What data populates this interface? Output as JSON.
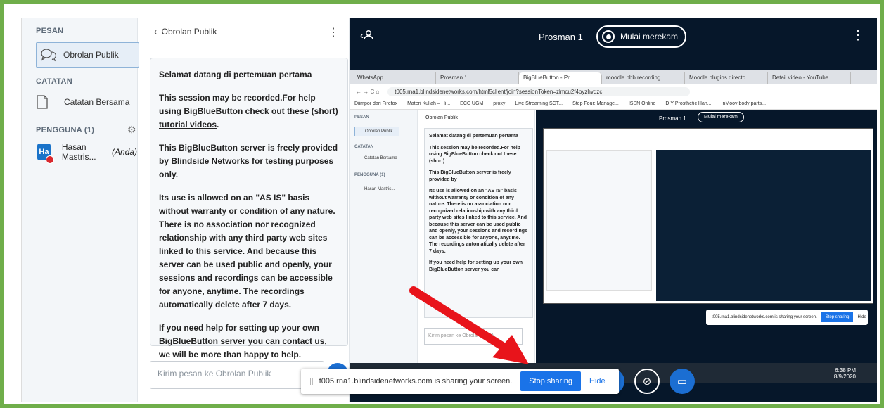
{
  "sidebar": {
    "messages_title": "PESAN",
    "public_chat": "Obrolan Publik",
    "notes_title": "CATATAN",
    "shared_notes": "Catatan Bersama",
    "users_title": "PENGGUNA (1)",
    "user": {
      "initials": "Ha",
      "name": "Hasan Mastris...",
      "role": "(Anda)"
    }
  },
  "chat": {
    "back_label": "Obrolan Publik",
    "welcome_title": "Selamat datang di pertemuan pertama",
    "p1_a": "This session may be recorded.For help using BigBlueButton check out these (short) ",
    "p1_link": "tutorial videos",
    "p1_end": ".",
    "p2_a": "This BigBlueButton server is freely provided by ",
    "p2_link": "Blindside Networks",
    "p2_b": " for testing purposes only.",
    "p3": "Its use is allowed on an \"AS IS\" basis without warranty or condition of any nature. There is no association nor recognized relationship with any third party web sites linked to this service. And because this server can be used public and openly, your sessions and recordings can be accessible for anyone, anytime. The recordings automatically delete after 7 days.",
    "p4_a": "If you need help for setting up your own BigBlueButton server you can ",
    "p4_link": "contact us",
    "p4_b": ", we will be more than happy to help.",
    "input_placeholder": "Kirim pesan ke Obrolan Publik"
  },
  "stage": {
    "meeting_name": "Prosman 1",
    "record_label": "Mulai merekam"
  },
  "browser": {
    "tabs": [
      "WhatsApp",
      "Prosman 1",
      "BigBlueButton - Pr",
      "moodle bbb recording",
      "Moodle plugins directo",
      "Detail video - YouTube"
    ],
    "url": "t005.rna1.blindsidenetworks.com/html5client/join?sessionToken=zlmcu2f4oyzhvdzc",
    "bookmarks": [
      "Diimpor dari Firefox",
      "Materi Kuliah – Hi...",
      "ECC UGM",
      "proxy",
      "Live Streaming SCT...",
      "Step Four: Manage...",
      "ISSN Online",
      "DIY Prosthetic Han...",
      "InMoov body parts..."
    ],
    "clock_time": "6:38 PM",
    "clock_date": "8/9/2020"
  },
  "share_banner": {
    "text": "t005.rna1.blindsidenetworks.com is sharing your screen.",
    "stop": "Stop sharing",
    "hide": "Hide"
  },
  "colors": {
    "frame": "#6fae4a",
    "stage": "#06172a",
    "accent": "#1b6ed2",
    "arrow": "#e8141b"
  }
}
